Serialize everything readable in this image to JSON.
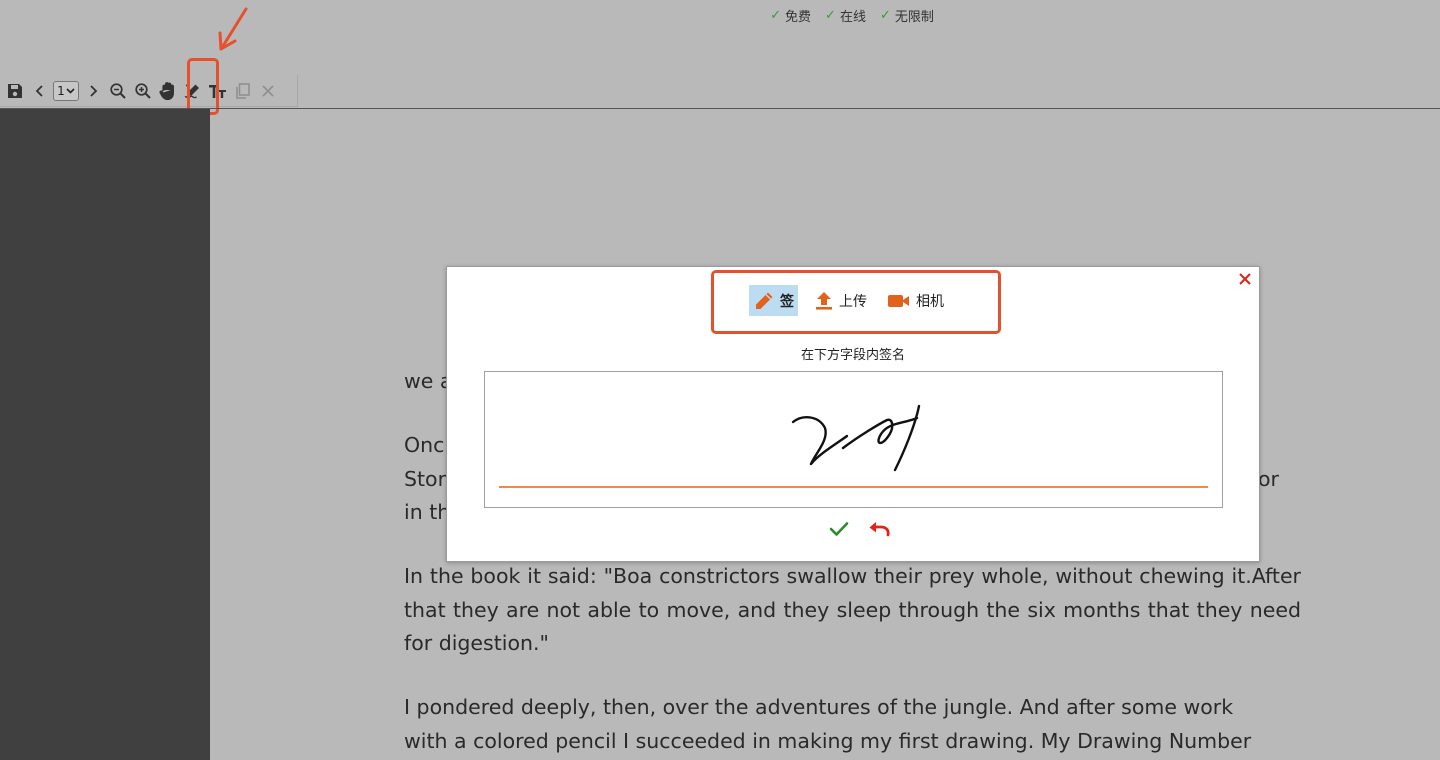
{
  "top_features": [
    {
      "check": "✓",
      "label": "免费"
    },
    {
      "check": "✓",
      "label": "在线"
    },
    {
      "check": "✓",
      "label": "无限制"
    }
  ],
  "toolbar": {
    "page_select_value": "1",
    "page_select_caret": "⌄",
    "buttons": [
      "save-icon",
      "chevron-left-icon",
      "chevron-right-icon",
      "zoom-out-icon",
      "zoom-in-icon",
      "hand-icon",
      "signature-icon",
      "text-size-icon",
      "copy-icon",
      "close-icon"
    ]
  },
  "dialog": {
    "tabs": [
      {
        "label": "签",
        "icon": "pencil-icon",
        "active": true
      },
      {
        "label": "上传",
        "icon": "upload-icon",
        "active": false
      },
      {
        "label": "相机",
        "icon": "camera-icon",
        "active": false
      }
    ],
    "instruction": "在下方字段内签名"
  },
  "document": {
    "lines": [
      "we a",
      "Onc",
      "Stor",
      "or",
      "in th"
    ],
    "paragraph1": "In the book it said: \"Boa constrictors swallow their prey whole, without chewing it.After that they are not able to move, and they sleep through the six months that they need for digestion.\"",
    "paragraph2_line1": "I pondered deeply, then, over the adventures of the jungle. And after some work",
    "paragraph2_line2": "with a colored pencil I succeeded in making my first drawing. My Drawing Number"
  },
  "colors": {
    "accent": "#e5512f",
    "icon_orange": "#e2621b",
    "confirm_green": "#2d8a2d",
    "undo_red": "#e0261b",
    "active_tab_bg": "#bcdcf2",
    "sidebar": "#404040",
    "page_bg": "#b9b9b9"
  }
}
